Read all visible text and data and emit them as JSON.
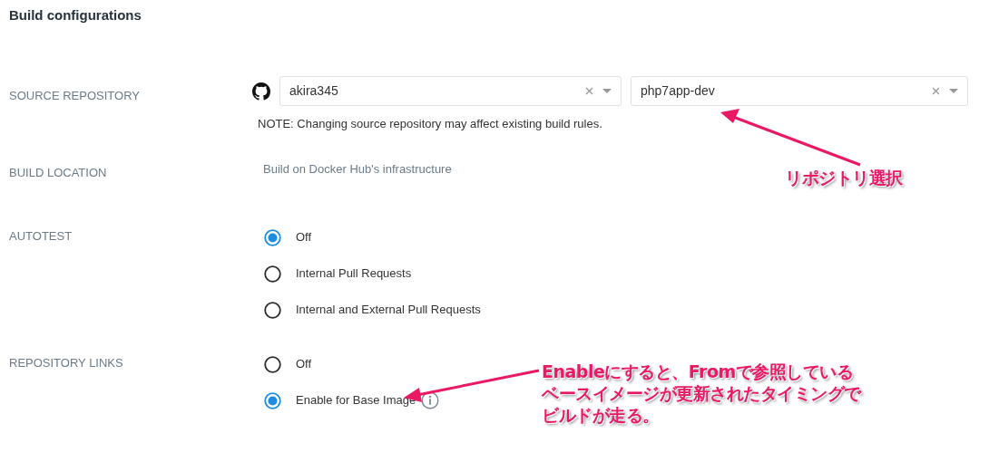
{
  "title": "Build configurations",
  "source_repository": {
    "label": "SOURCE REPOSITORY",
    "selects": [
      {
        "value": "akira345",
        "provider_icon": true
      },
      {
        "value": "php7app-dev",
        "provider_icon": false
      }
    ],
    "note": "NOTE: Changing source repository may affect existing build rules."
  },
  "build_location": {
    "label": "BUILD LOCATION",
    "value": "Build on Docker Hub's infrastructure"
  },
  "autotest": {
    "label": "AUTOTEST",
    "options": [
      {
        "label": "Off",
        "selected": true,
        "info": false
      },
      {
        "label": "Internal Pull Requests",
        "selected": false,
        "info": false
      },
      {
        "label": "Internal and External Pull Requests",
        "selected": false,
        "info": false
      }
    ]
  },
  "repository_links": {
    "label": "REPOSITORY LINKS",
    "options": [
      {
        "label": "Off",
        "selected": false,
        "info": false
      },
      {
        "label": "Enable for Base Image",
        "selected": true,
        "info": true
      }
    ]
  },
  "annotations": [
    {
      "text": "リポジトリ選択"
    },
    {
      "lines": [
        "Enableにすると、Fromで参照している",
        "ベースイメージが更新されたタイミングで",
        "ビルドが走る。"
      ]
    }
  ]
}
